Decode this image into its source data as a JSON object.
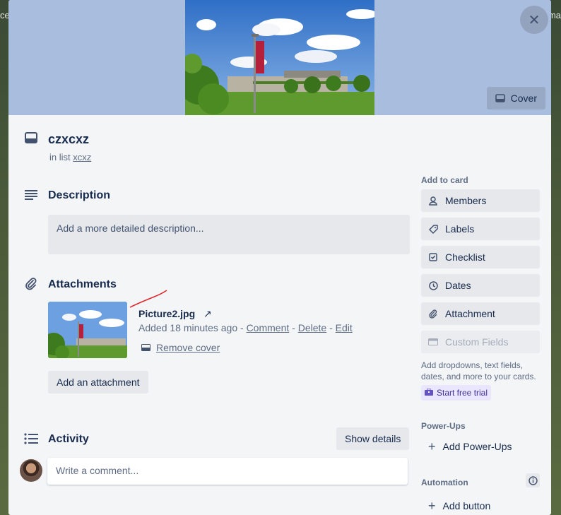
{
  "background": {
    "left_text": "ce",
    "right_text": "ma"
  },
  "cover": {
    "button_label": "Cover"
  },
  "card": {
    "title": "czxcxz",
    "list_prefix": "in list",
    "list_name": "xcxz"
  },
  "description": {
    "heading": "Description",
    "placeholder": "Add a more detailed description..."
  },
  "attachments": {
    "heading": "Attachments",
    "items": [
      {
        "name": "Picture2.jpg",
        "added": "Added 18 minutes ago",
        "sep": "-",
        "comment": "Comment",
        "delete": "Delete",
        "edit": "Edit",
        "remove_cover": "Remove cover"
      }
    ],
    "add_button": "Add an attachment"
  },
  "activity": {
    "heading": "Activity",
    "show_details": "Show details",
    "comment_placeholder": "Write a comment..."
  },
  "sidebar": {
    "add_to_card_label": "Add to card",
    "buttons": {
      "members": "Members",
      "labels": "Labels",
      "checklist": "Checklist",
      "dates": "Dates",
      "attachment": "Attachment",
      "custom_fields": "Custom Fields"
    },
    "custom_fields_note": "Add dropdowns, text fields, dates, and more to your cards.",
    "trial_label": "Start free trial",
    "powerups_label": "Power-Ups",
    "add_powerups": "Add Power-Ups",
    "automation_label": "Automation",
    "add_button": "Add button"
  },
  "colors": {
    "cover_bg": "#a9bedf",
    "modal_bg": "#f4f5f7",
    "button_bg": "#e6e8ec",
    "text_primary": "#172b4d",
    "text_secondary": "#5e6c84",
    "trial_bg": "#eae6ff",
    "trial_text": "#403294",
    "red_mark": "#e0242a"
  }
}
